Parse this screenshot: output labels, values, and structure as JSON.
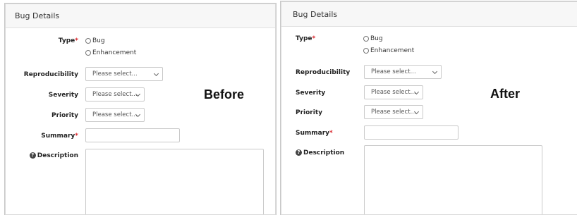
{
  "panel_title": "Bug Details",
  "fields": {
    "type_label": "Type",
    "required_mark": "*",
    "type_options": [
      "Bug",
      "Enhancement"
    ],
    "reproducibility_label": "Reproducibility",
    "severity_label": "Severity",
    "priority_label": "Priority",
    "summary_label": "Summary",
    "description_label": "Description",
    "select_placeholder_long": "Please select...",
    "select_placeholder_short": "Please select..."
  },
  "captions": {
    "before": "Before",
    "after": "After"
  },
  "icons": {
    "description_help": "question-circle-icon",
    "select_arrow": "chevron-down-icon"
  },
  "colors": {
    "required": "#d9262c"
  }
}
